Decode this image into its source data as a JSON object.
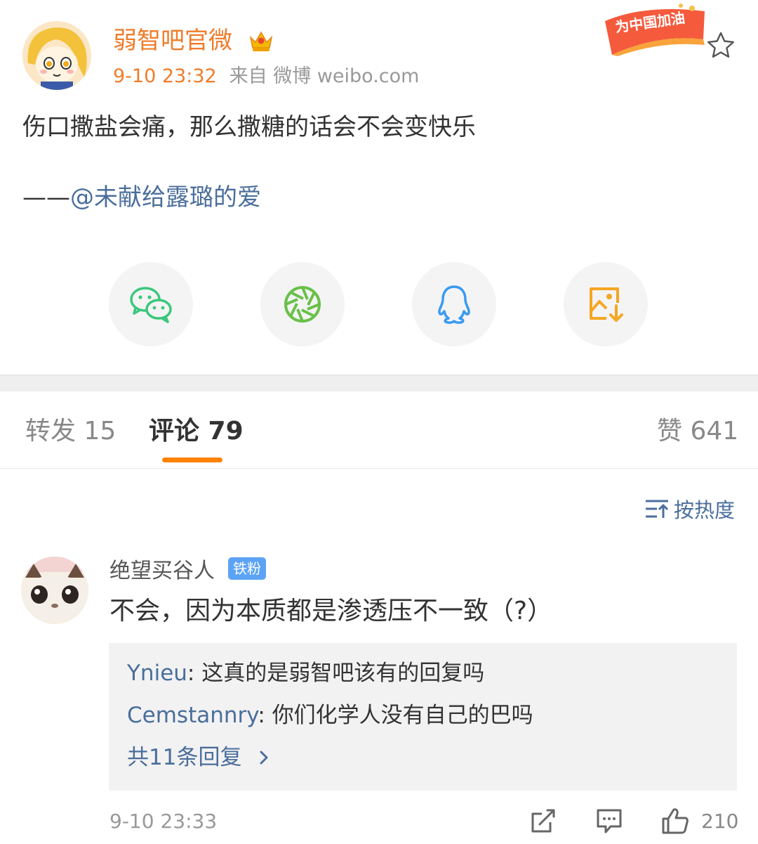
{
  "post": {
    "author": "弱智吧官微",
    "time": "9-10 23:32",
    "source": "来自 微博 weibo.com",
    "badge_text": "为中国加油",
    "text": "伤口撒盐会痛，那么撒糖的话会不会变快乐",
    "attribution_prefix": "——",
    "attribution_mention": "@未献给露璐的爱"
  },
  "share": {
    "items": [
      {
        "icon": "wechat-icon"
      },
      {
        "icon": "moments-icon"
      },
      {
        "icon": "qq-icon"
      },
      {
        "icon": "save-image-icon"
      }
    ]
  },
  "tabs": {
    "repost": "转发 15",
    "comments": "评论 79",
    "likes": "赞 641"
  },
  "sort": {
    "label": "按热度"
  },
  "comment": {
    "user": "绝望买谷人",
    "badge": "铁粉",
    "text": "不会，因为本质都是渗透压不一致（?）",
    "replies": [
      {
        "user": "Ynieu",
        "text": ": 这真的是弱智吧该有的回复吗"
      },
      {
        "user": "Cemstannry",
        "text": ": 你们化学人没有自己的巴吗"
      }
    ],
    "more_replies": "共11条回复",
    "time": "9-10 23:33",
    "like_count": "210"
  },
  "colors": {
    "accent_orange": "#f07c2a",
    "link_blue": "#4a6e9c",
    "tab_underline": "#ff8200",
    "wechat_green": "#3cc77d",
    "qq_blue": "#3a9af2",
    "save_orange": "#f5a623"
  }
}
